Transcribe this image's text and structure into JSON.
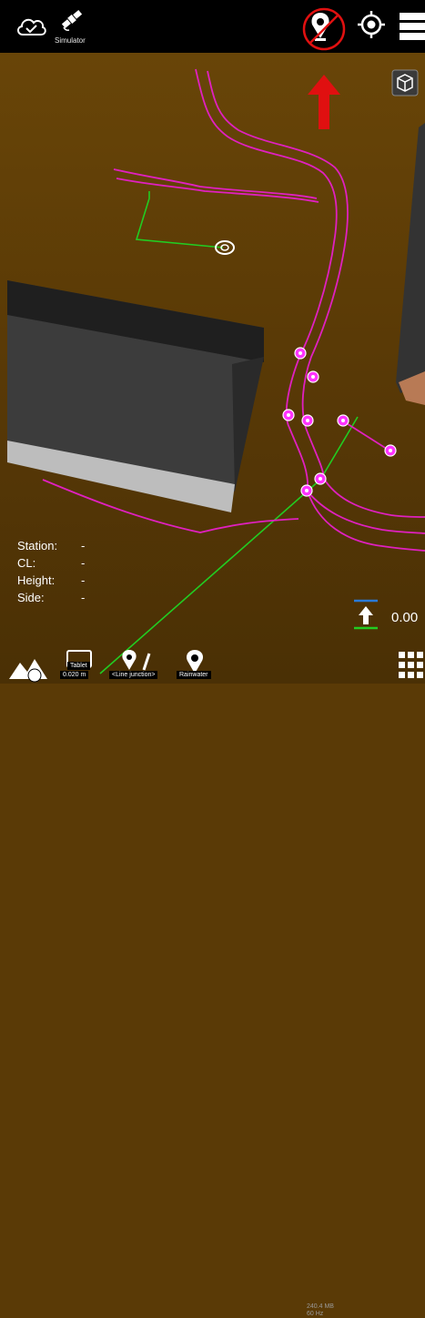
{
  "topbar": {
    "simulator_label": "Simulator"
  },
  "info_panel": {
    "rows": [
      {
        "label": "Station:",
        "value": "-"
      },
      {
        "label": "CL:",
        "value": "-"
      },
      {
        "label": "Height:",
        "value": "-"
      },
      {
        "label": "Side:",
        "value": "-"
      }
    ]
  },
  "elevation_indicator": {
    "value": "0.00"
  },
  "bottombar": {
    "tablet_label": "Tablet",
    "tablet_value": "0.020 m",
    "line_label": "<Line junction>",
    "pipe_label": "Rainwater",
    "memory_text": "240.4 MB",
    "frequency_text": "60 Hz"
  },
  "colors": {
    "ground": "#5a3a06",
    "pipe": "#e020c0",
    "pipe_node": "#ff33ff",
    "green_line": "#22cc22",
    "red_marker": "#e01010",
    "building_top": "#2e2e2e",
    "building_side": "#3a3a3a"
  },
  "icons": [
    "cloud-check-icon",
    "satellite-icon",
    "cancel-marker-icon",
    "red-arrow-icon",
    "locate-icon",
    "layers-icon",
    "3d-cube-icon",
    "terrain-icon",
    "tablet-icon",
    "line-junction-icon",
    "pipe-icon",
    "grid-menu-icon"
  ]
}
